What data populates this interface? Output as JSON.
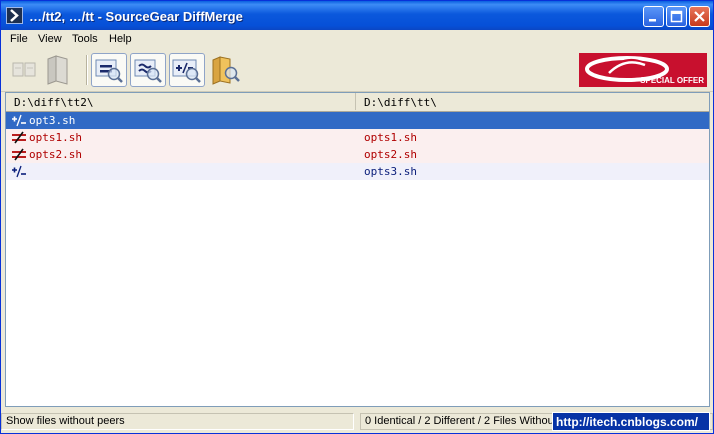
{
  "window": {
    "title": "…/tt2, …/tt - SourceGear DiffMerge"
  },
  "menu": [
    "File",
    "View",
    "Tools",
    "Help"
  ],
  "toolbar": {
    "buttons": [
      {
        "name": "open-file-compare",
        "icon": "two-pages-icon",
        "enabled": false
      },
      {
        "name": "open-folder-compare",
        "icon": "folders-icon",
        "enabled": false
      },
      {
        "name": "show-identical",
        "icon": "equal-magnifier-icon",
        "label": "="
      },
      {
        "name": "show-different",
        "icon": "approx-magnifier-icon",
        "label": "≈"
      },
      {
        "name": "show-peerless",
        "icon": "plusminus-magnifier-icon",
        "label": "+/-"
      },
      {
        "name": "browse-folder",
        "icon": "folder-magnifier-icon"
      }
    ],
    "banner": "SPECIAL OFFER"
  },
  "columns": [
    "D:\\diff\\tt2\\",
    "D:\\diff\\tt\\"
  ],
  "rows": [
    {
      "status": "peerless",
      "left": "opt3.sh",
      "right": "",
      "selected": true
    },
    {
      "status": "different",
      "left": "opts1.sh",
      "right": "opts1.sh",
      "selected": false
    },
    {
      "status": "different",
      "left": "opts2.sh",
      "right": "opts2.sh",
      "selected": false
    },
    {
      "status": "peerless",
      "left": "",
      "right": "opts3.sh",
      "selected": false
    }
  ],
  "status": {
    "left": "Show files without peers",
    "right": "0 Identical / 2 Different / 2 Files Without Peers"
  },
  "watermark": "http://itech.cnblogs.com/",
  "colors": {
    "titlebar": "#0a5fe0",
    "selection": "#316ac5",
    "different_row_bg": "#fbefef",
    "different_text": "#b00000",
    "peerless_row_bg": "#f0f0fa",
    "peerless_text": "#0a1e7a",
    "banner": "#c8102e"
  }
}
